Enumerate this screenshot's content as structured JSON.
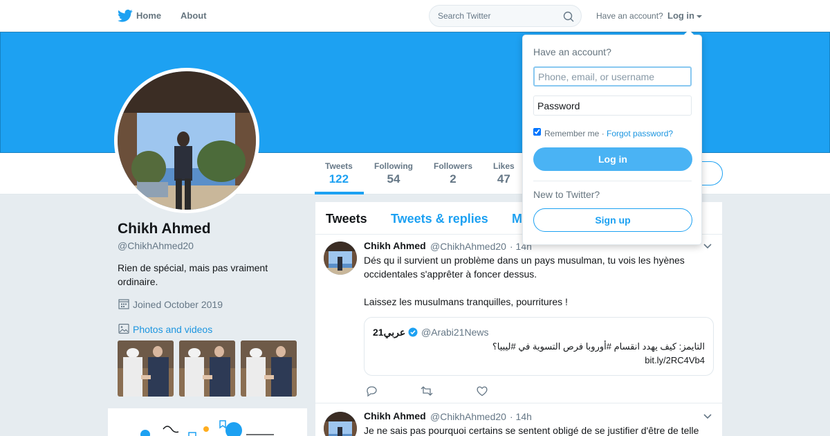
{
  "nav": {
    "home_label": "Home",
    "about_label": "About",
    "search_placeholder": "Search Twitter",
    "have_account_label": "Have an account?",
    "login_label": "Log in"
  },
  "colors": {
    "brand_blue": "#1da1f2",
    "link_blue": "#1b95e0",
    "text_primary": "#14171a",
    "text_secondary": "#657786"
  },
  "profile": {
    "name": "Chikh Ahmed",
    "handle": "@ChikhAhmed20",
    "bio": "Rien de spécial, mais pas vraiment ordinaire.",
    "joined": "Joined October 2019",
    "photos_label": "Photos and videos"
  },
  "stats": [
    {
      "label": "Tweets",
      "value": "122"
    },
    {
      "label": "Following",
      "value": "54"
    },
    {
      "label": "Followers",
      "value": "2"
    },
    {
      "label": "Likes",
      "value": "47"
    }
  ],
  "tabs": {
    "tweets": "Tweets",
    "replies": "Tweets & replies",
    "media": "M"
  },
  "tweets": [
    {
      "name": "Chikh Ahmed",
      "handle": "@ChikhAhmed20",
      "time": "· 14h",
      "text": "Dés qu il survient un problème dans un pays musulman, tu vois les hyènes occidentales s'apprêter à foncer dessus.\n\nLaissez les musulmans tranquilles, pourritures !",
      "quote": {
        "name": "عربي21",
        "handle": "@Arabi21News",
        "text": "التايمز: كيف يهدد انقسام #أوروبا فرص التسوية في #ليبيا؟",
        "link": "bit.ly/2RC4Vb4"
      }
    },
    {
      "name": "Chikh Ahmed",
      "handle": "@ChikhAhmed20",
      "time": "· 14h",
      "text": "Je ne sais pas pourquoi certains se sentent obligé de se justifier d'être de telle"
    }
  ],
  "login_dropdown": {
    "title": "Have an account?",
    "username_placeholder": "Phone, email, or username",
    "password_placeholder": "Password",
    "remember_label": "Remember me ·",
    "forgot_label": "Forgot password?",
    "login_button": "Log in",
    "new_label": "New to Twitter?",
    "signup_button": "Sign up"
  }
}
